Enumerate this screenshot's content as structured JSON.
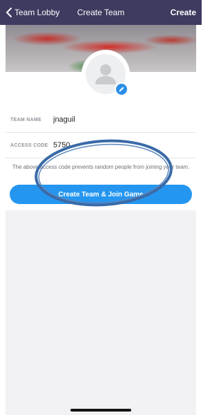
{
  "nav": {
    "back_label": "Team Lobby",
    "title": "Create Team",
    "action_label": "Create"
  },
  "avatar": {
    "icon": "person-icon",
    "edit_icon": "pencil-icon"
  },
  "form": {
    "team_name_label": "TEAM NAME",
    "team_name_value": "jnaguil",
    "access_code_label": "ACCESS CODE",
    "access_code_value": "5750"
  },
  "hint": {
    "text": "The above access code prevents random people from joining your team."
  },
  "cta": {
    "label": "Create Team & Join Game"
  },
  "colors": {
    "nav_bg": "#3d3b5f",
    "accent": "#2596f0",
    "annotation": "#3a6aa8"
  }
}
